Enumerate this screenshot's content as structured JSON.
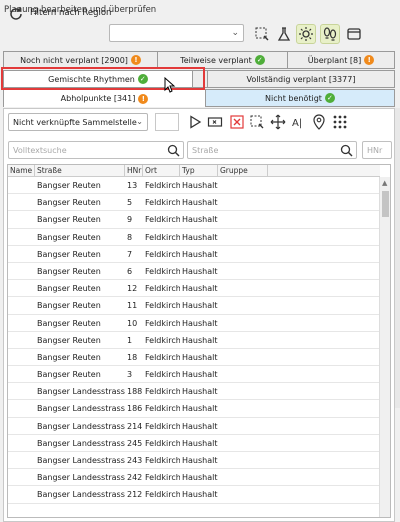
{
  "window": {
    "title": "Planung bearbeiten und überprüfen"
  },
  "toolbar": {
    "filter_label": "Filtern nach Region",
    "region_value": "",
    "icons": [
      "refresh-icon",
      "select-area-icon",
      "flask-icon",
      "sun-icon",
      "footprints-icon",
      "window-icon"
    ]
  },
  "tabs_row1": [
    {
      "label": "Noch nicht verplant [2900]",
      "badge": "warn"
    },
    {
      "label": "Teilweise verplant",
      "badge": "ok"
    },
    {
      "label": "Überplant [8]",
      "badge": "warn"
    }
  ],
  "tabs_row2": [
    {
      "label": "Gemischte Rhythmen",
      "badge": "ok"
    },
    {
      "label": "Vollständig verplant [3377]",
      "badge": ""
    }
  ],
  "tabs_row3": [
    {
      "label": "Abholpunkte [341]",
      "badge": "warn"
    },
    {
      "label": "Nicht benötigt",
      "badge": "ok"
    }
  ],
  "filters": {
    "sammelstelle": "Nicht verknüpfte Sammelstelle",
    "fulltext_placeholder": "Volltextsuche",
    "street_placeholder": "Straße",
    "hnr_placeholder": "HNr"
  },
  "colors": {
    "warn": "#f08a1c",
    "ok": "#4fae3a",
    "highlight": "#e23a3a",
    "selected_tab": "#d6ebfa"
  },
  "table": {
    "columns": [
      "Name",
      "Straße",
      "HNr",
      "Ort",
      "Typ",
      "Gruppe"
    ],
    "rows": [
      [
        "",
        "Bangser Reuten",
        "13",
        "Feldkirch",
        "Haushalt",
        ""
      ],
      [
        "",
        "Bangser Reuten",
        "5",
        "Feldkirch",
        "Haushalt",
        ""
      ],
      [
        "",
        "Bangser Reuten",
        "9",
        "Feldkirch",
        "Haushalt",
        ""
      ],
      [
        "",
        "Bangser Reuten",
        "8",
        "Feldkirch",
        "Haushalt",
        ""
      ],
      [
        "",
        "Bangser Reuten",
        "7",
        "Feldkirch",
        "Haushalt",
        ""
      ],
      [
        "",
        "Bangser Reuten",
        "6",
        "Feldkirch",
        "Haushalt",
        ""
      ],
      [
        "",
        "Bangser Reuten",
        "12",
        "Feldkirch",
        "Haushalt",
        ""
      ],
      [
        "",
        "Bangser Reuten",
        "11",
        "Feldkirch",
        "Haushalt",
        ""
      ],
      [
        "",
        "Bangser Reuten",
        "10",
        "Feldkirch",
        "Haushalt",
        ""
      ],
      [
        "",
        "Bangser Reuten",
        "1",
        "Feldkirch",
        "Haushalt",
        ""
      ],
      [
        "",
        "Bangser Reuten",
        "18",
        "Feldkirch",
        "Haushalt",
        ""
      ],
      [
        "",
        "Bangser Reuten",
        "3",
        "Feldkirch",
        "Haushalt",
        ""
      ],
      [
        "",
        "Bangser Landesstrasse",
        "188",
        "Feldkirch",
        "Haushalt",
        ""
      ],
      [
        "",
        "Bangser Landesstrasse",
        "186",
        "Feldkirch",
        "Haushalt",
        ""
      ],
      [
        "",
        "Bangser Landesstrasse",
        "214",
        "Feldkirch",
        "Haushalt",
        ""
      ],
      [
        "",
        "Bangser Landesstrasse",
        "245",
        "Feldkirch",
        "Haushalt",
        ""
      ],
      [
        "",
        "Bangser Landesstrasse",
        "243",
        "Feldkirch",
        "Haushalt",
        ""
      ],
      [
        "",
        "Bangser Landesstrasse",
        "242",
        "Feldkirch",
        "Haushalt",
        ""
      ],
      [
        "",
        "Bangser Landesstrasse",
        "212",
        "Feldkirch",
        "Haushalt",
        ""
      ]
    ]
  }
}
